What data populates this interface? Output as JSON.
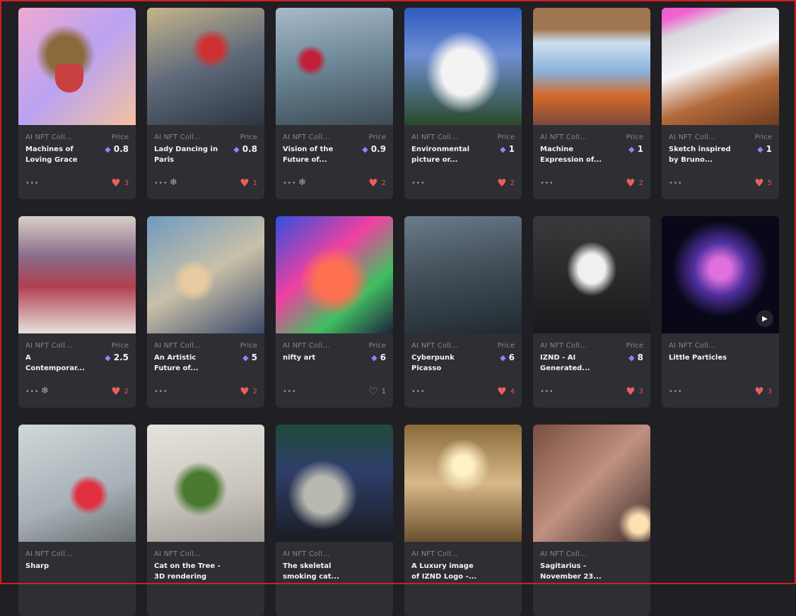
{
  "cards": [
    {
      "collection": "AI NFT Coll...",
      "title": "Machines of Loving Grace",
      "price_label": "Price",
      "price": "0.8",
      "likes": "3",
      "liked": true,
      "flake": false
    },
    {
      "collection": "AI NFT Coll...",
      "title": "Lady Dancing in Paris",
      "price_label": "Price",
      "price": "0.8",
      "likes": "1",
      "liked": true,
      "flake": true
    },
    {
      "collection": "AI NFT Coll...",
      "title": "Vision of the Future of...",
      "price_label": "Price",
      "price": "0.9",
      "likes": "2",
      "liked": true,
      "flake": true
    },
    {
      "collection": "AI NFT Coll...",
      "title": "Environmental picture or...",
      "price_label": "Price",
      "price": "1",
      "likes": "2",
      "liked": true,
      "flake": false
    },
    {
      "collection": "AI NFT Coll...",
      "title": "Machine Expression of...",
      "price_label": "Price",
      "price": "1",
      "likes": "2",
      "liked": true,
      "flake": false
    },
    {
      "collection": "AI NFT Coll...",
      "title": "Sketch inspired by Bruno...",
      "price_label": "Price",
      "price": "1",
      "likes": "5",
      "liked": true,
      "flake": false
    },
    {
      "collection": "AI NFT Coll...",
      "title": "A Contemporar...",
      "price_label": "Price",
      "price": "2.5",
      "likes": "2",
      "liked": true,
      "flake": true
    },
    {
      "collection": "AI NFT Coll...",
      "title": "An Artistic Future of...",
      "price_label": "Price",
      "price": "5",
      "likes": "2",
      "liked": true,
      "flake": false
    },
    {
      "collection": "AI NFT Coll...",
      "title": "nifty art",
      "price_label": "Price",
      "price": "6",
      "likes": "1",
      "liked": false,
      "flake": false
    },
    {
      "collection": "AI NFT Coll...",
      "title": "Cyberpunk Picasso",
      "price_label": "Price",
      "price": "6",
      "likes": "4",
      "liked": true,
      "flake": false
    },
    {
      "collection": "AI NFT Coll...",
      "title": "IZND - AI Generated...",
      "price_label": "Price",
      "price": "8",
      "likes": "3",
      "liked": true,
      "flake": false
    },
    {
      "collection": "AI NFT Coll...",
      "title": "Little Particles",
      "price_label": "",
      "price": "",
      "likes": "3",
      "liked": true,
      "flake": false,
      "play": true
    },
    {
      "collection": "AI NFT Coll...",
      "title": "Sharp",
      "price_label": "",
      "price": "",
      "likes": "",
      "liked": false,
      "flake": false
    },
    {
      "collection": "AI NFT Coll...",
      "title": "Cat on the Tree - 3D rendering",
      "price_label": "",
      "price": "",
      "likes": "",
      "liked": false,
      "flake": false
    },
    {
      "collection": "AI NFT Coll...",
      "title": "The skeletal smoking cat...",
      "price_label": "",
      "price": "",
      "likes": "",
      "liked": false,
      "flake": false
    },
    {
      "collection": "AI NFT Coll...",
      "title": "A Luxury image of IZND Logo -...",
      "price_label": "",
      "price": "",
      "likes": "",
      "liked": false,
      "flake": false
    },
    {
      "collection": "AI NFT Coll...",
      "title": "Sagitarius - November 23...",
      "price_label": "",
      "price": "",
      "likes": "",
      "liked": false,
      "flake": false
    }
  ],
  "icons": {
    "more": "more-dots-icon",
    "heart": "heart-icon",
    "flake": "snowflake-icon",
    "eth": "ethereum-icon",
    "play": "play-icon"
  },
  "colors": {
    "background": "#1f1f24",
    "card": "#2e2e35",
    "like": "#ee5d5a",
    "eth": "#9b7df5",
    "frame": "#d02020"
  }
}
